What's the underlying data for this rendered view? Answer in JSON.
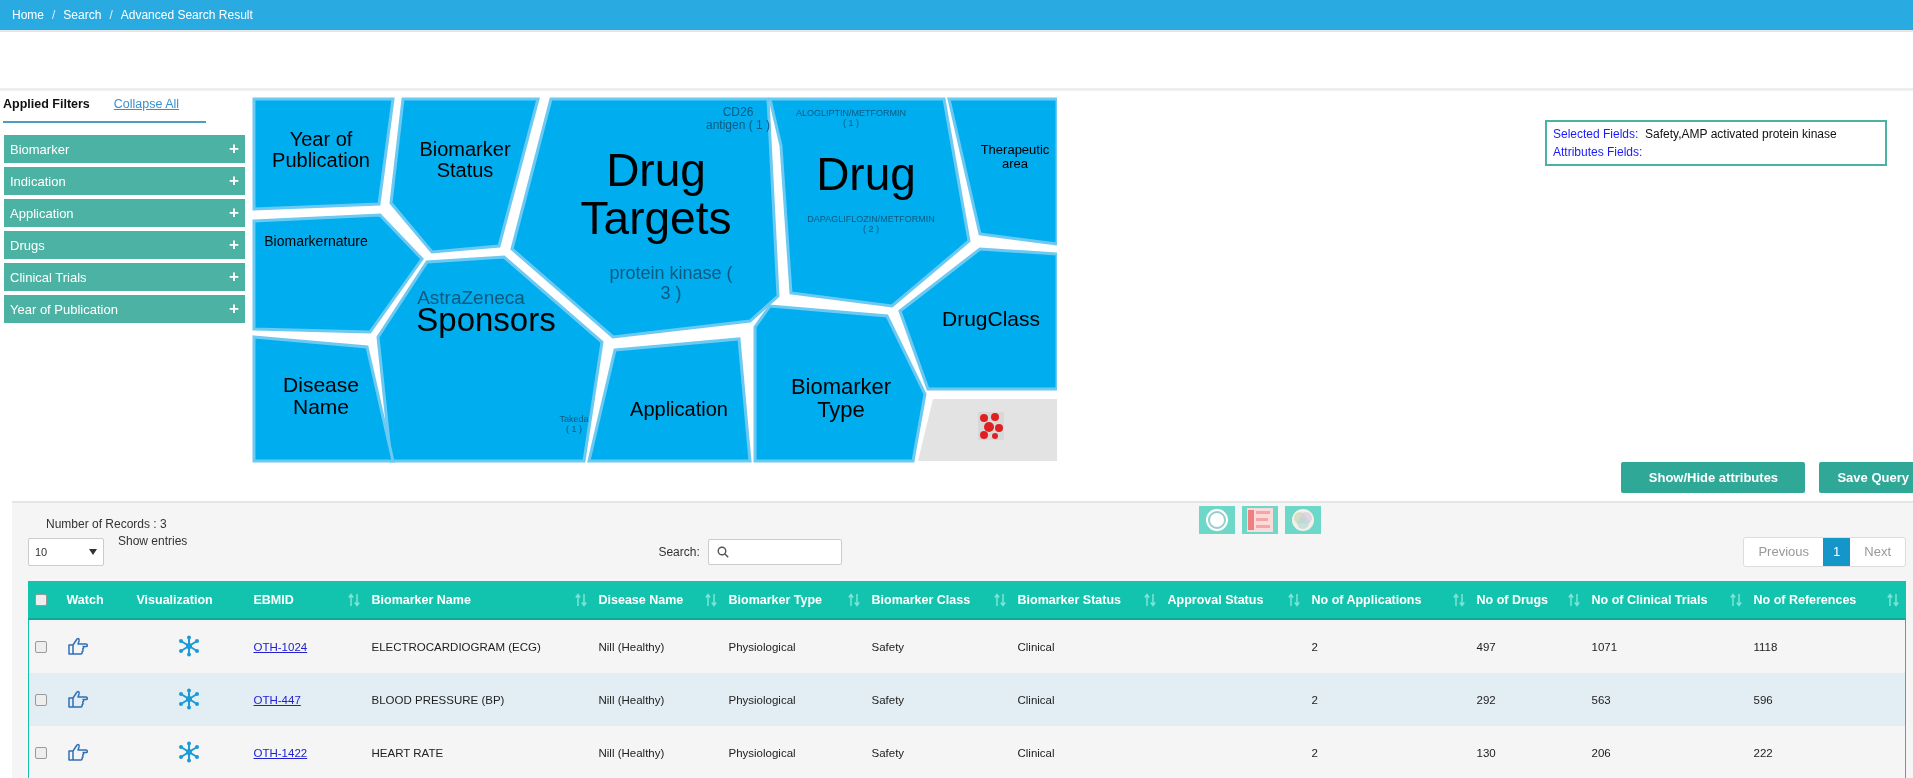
{
  "breadcrumb": [
    "Home",
    "Search",
    "Advanced Search Result"
  ],
  "breadcrumb_separator": "/",
  "filters": {
    "title": "Applied Filters",
    "collapse_link": "Collapse All",
    "items": [
      {
        "label": "Biomarker",
        "icon": "+"
      },
      {
        "label": "Indication",
        "icon": "+"
      },
      {
        "label": "Application",
        "icon": "+"
      },
      {
        "label": "Drugs",
        "icon": "+"
      },
      {
        "label": "Clinical Trials",
        "icon": "+"
      },
      {
        "label": "Year of Publication",
        "icon": "+"
      }
    ]
  },
  "treemap": {
    "cells": [
      {
        "lines": [
          "Year of",
          "Publication"
        ]
      },
      {
        "lines": [
          "Biomarker",
          "Status"
        ]
      },
      {
        "lines": [
          "Drug",
          "Targets"
        ],
        "faded": [
          [
            "CD26",
            "antigen ( 1 )"
          ],
          [
            "protein kinase (",
            "3 )"
          ]
        ]
      },
      {
        "lines": [
          "Drug"
        ],
        "faded": [
          [
            "ALOGLIPTIN/METFORMIN",
            "( 1 )"
          ],
          [
            "DAPAGLIFLOZIN/METFORMIN",
            "( 2 )"
          ]
        ]
      },
      {
        "lines": [
          "Therapeutic",
          "area"
        ]
      },
      {
        "lines": [
          "Biomarkernature"
        ]
      },
      {
        "lines": [
          "Sponsors"
        ],
        "faded": [
          [
            "AstraZeneca"
          ],
          [
            "Takeda",
            "( 1 )"
          ]
        ]
      },
      {
        "lines": [
          "Disease",
          "Name"
        ]
      },
      {
        "lines": [
          "Application"
        ]
      },
      {
        "lines": [
          "Biomarker",
          "Type"
        ]
      },
      {
        "lines": [
          "DrugClass"
        ]
      }
    ]
  },
  "selected_box": {
    "selected_label": "Selected Fields:",
    "selected_value": "Safety,AMP activated protein kinase",
    "attributes_label": "Attributes Fields:"
  },
  "buttons": [
    "Show/Hide attributes",
    "Save Query"
  ],
  "records": "Number of Records : 3",
  "page_size": "10",
  "show_entries": "Show entries",
  "search_label": "Search:",
  "pagination": {
    "previous": "Previous",
    "pages": [
      {
        "label": "1",
        "selected": true
      }
    ],
    "next": "Next"
  },
  "table": {
    "header_checked": false,
    "columns": [
      {
        "label": "Watch",
        "sortable": false,
        "kind": "watch"
      },
      {
        "label": "Visualization",
        "sortable": false,
        "kind": "visualization"
      },
      {
        "label": "EBMID",
        "sortable": true,
        "kind": "link"
      },
      {
        "label": "Biomarker Name",
        "sortable": true,
        "kind": "text"
      },
      {
        "label": "Disease Name",
        "sortable": true,
        "kind": "text"
      },
      {
        "label": "Biomarker Type",
        "sortable": true,
        "kind": "text"
      },
      {
        "label": "Biomarker Class",
        "sortable": true,
        "kind": "text"
      },
      {
        "label": "Biomarker Status",
        "sortable": true,
        "kind": "text"
      },
      {
        "label": "Approval Status",
        "sortable": true,
        "kind": "text"
      },
      {
        "label": "No of Applications",
        "sortable": true,
        "kind": "text"
      },
      {
        "label": "No of Drugs",
        "sortable": true,
        "kind": "text"
      },
      {
        "label": "No of Clinical Trials",
        "sortable": true,
        "kind": "text"
      },
      {
        "label": "No of References",
        "sortable": true,
        "kind": "text"
      }
    ],
    "rows": [
      {
        "checked": false,
        "cells": [
          "",
          "",
          "OTH-1024",
          "ELECTROCARDIOGRAM (ECG)",
          "Nill (Healthy)",
          "Physiological",
          "Safety",
          "Clinical",
          "",
          "2",
          "497",
          "1071",
          "1118"
        ]
      },
      {
        "checked": false,
        "cells": [
          "",
          "",
          "OTH-447",
          "BLOOD PRESSURE (BP)",
          "Nill (Healthy)",
          "Physiological",
          "Safety",
          "Clinical",
          "",
          "2",
          "292",
          "563",
          "596"
        ]
      },
      {
        "checked": false,
        "cells": [
          "",
          "",
          "OTH-1422",
          "HEART RATE",
          "Nill (Healthy)",
          "Physiological",
          "Safety",
          "Clinical",
          "",
          "2",
          "130",
          "206",
          "222"
        ]
      }
    ]
  }
}
